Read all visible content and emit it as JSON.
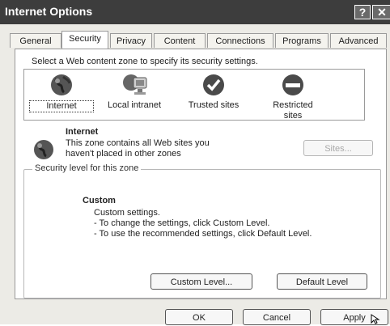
{
  "window": {
    "title": "Internet Options",
    "help_glyph": "?",
    "close_glyph": "✕"
  },
  "tabs": [
    {
      "label": "General"
    },
    {
      "label": "Security"
    },
    {
      "label": "Privacy"
    },
    {
      "label": "Content"
    },
    {
      "label": "Connections"
    },
    {
      "label": "Programs"
    },
    {
      "label": "Advanced"
    }
  ],
  "security": {
    "instruction": "Select a Web content zone to specify its security settings.",
    "zones": [
      {
        "label": "Internet",
        "icon": "globe-icon",
        "selected": true
      },
      {
        "label": "Local intranet",
        "icon": "computer-icon"
      },
      {
        "label": "Trusted sites",
        "icon": "checkmark-icon"
      },
      {
        "label": "Restricted sites",
        "icon": "no-entry-icon"
      }
    ],
    "zone_title": "Internet",
    "zone_desc_line1": "This zone contains all Web sites you",
    "zone_desc_line2": "haven't placed in other zones",
    "sites_button": "Sites...",
    "level_group_label": "Security level for this zone",
    "level_title": "Custom",
    "level_line1": "Custom settings.",
    "level_line2": "- To change the settings, click Custom Level.",
    "level_line3": "- To use the recommended settings, click Default Level.",
    "custom_level_button": "Custom Level...",
    "default_level_button": "Default Level"
  },
  "footer": {
    "ok": "OK",
    "cancel": "Cancel",
    "apply": "Apply"
  }
}
